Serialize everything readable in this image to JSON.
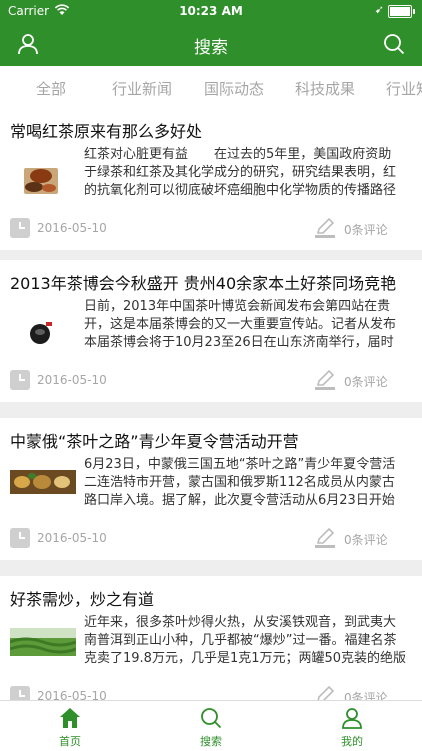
{
  "status_bar": {
    "carrier": "Carrier",
    "time": "10:23 AM"
  },
  "nav": {
    "title": "搜索"
  },
  "tabs": [
    {
      "label": "全部"
    },
    {
      "label": "行业新闻"
    },
    {
      "label": "国际动态"
    },
    {
      "label": "科技成果"
    },
    {
      "label": "行业知"
    }
  ],
  "articles": [
    {
      "title": "常喝红茶原来有那么多好处",
      "summary": [
        "红茶对心脏更有益　　在过去的5年里，美国政府资助",
        "于绿茶和红茶及其化学成分的研究，研究结果表明，红",
        "的抗氧化剂可以彻底破坏癌细胞中化学物质的传播路径"
      ],
      "date": "2016-05-10",
      "comments": "0条评论"
    },
    {
      "title": "2013年茶博会今秋盛开 贵州40余家本土好茶同场竞艳",
      "summary": [
        "日前，2013年中国茶叶博览会新闻发布会第四站在贵",
        "开，这是本届茶博会的又一大重要宣传站。记者从发布",
        "本届茶博会将于10月23至26日在山东济南举行，届时"
      ],
      "date": "2016-05-10",
      "comments": "0条评论"
    },
    {
      "title": "中蒙俄“茶叶之路”青少年夏令营活动开营",
      "summary": [
        "6月23日，中蒙俄三国五地“茶叶之路”青少年夏令营活",
        "二连浩特市开营，蒙古国和俄罗斯112名成员从内蒙古",
        "路口岸入境。据了解，此次夏令营活动从6月23日开始"
      ],
      "date": "2016-05-10",
      "comments": "0条评论"
    },
    {
      "title": "好茶需炒，炒之有道",
      "summary": [
        "近年来，很多茶叶炒得火热，从安溪铁观音，到武夷大",
        "南普洱到正山小种，几乎都被“爆炒”过一番。福建名茶",
        "克卖了19.8万元，几乎是1克1万元；两罐50克装的绝版"
      ],
      "date": "2016-05-10",
      "comments": "0条评论"
    }
  ],
  "tab_bar": [
    {
      "label": "首页"
    },
    {
      "label": "搜索"
    },
    {
      "label": "我的"
    }
  ],
  "colors": {
    "brand": "#2f8f2a",
    "muted": "#a6a6a6"
  }
}
